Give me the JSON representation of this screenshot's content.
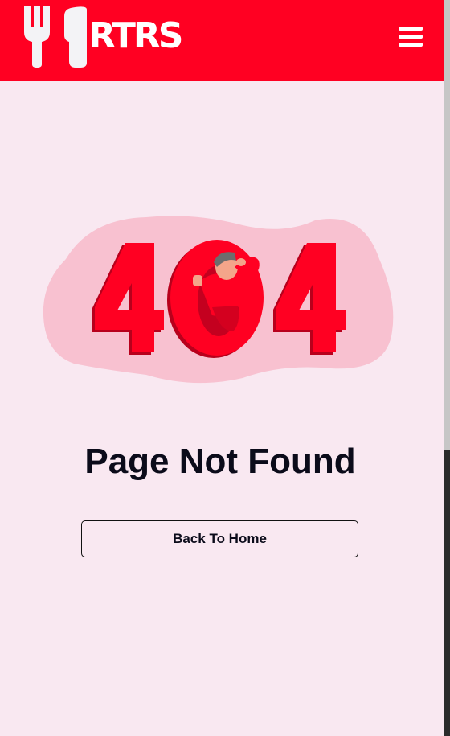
{
  "header": {
    "logo_text": "RTRS",
    "menu_icon": "hamburger-menu-icon",
    "background_color": "#ff0022"
  },
  "error": {
    "code": "404",
    "title": "Page Not Found",
    "illustration": "person-peeking-through-zero"
  },
  "actions": {
    "back_home_label": "Back To Home"
  },
  "colors": {
    "accent": "#ff0022",
    "page_background": "#f9e8f1",
    "blob": "#f8c1d0",
    "text": "#0b0b1a"
  }
}
